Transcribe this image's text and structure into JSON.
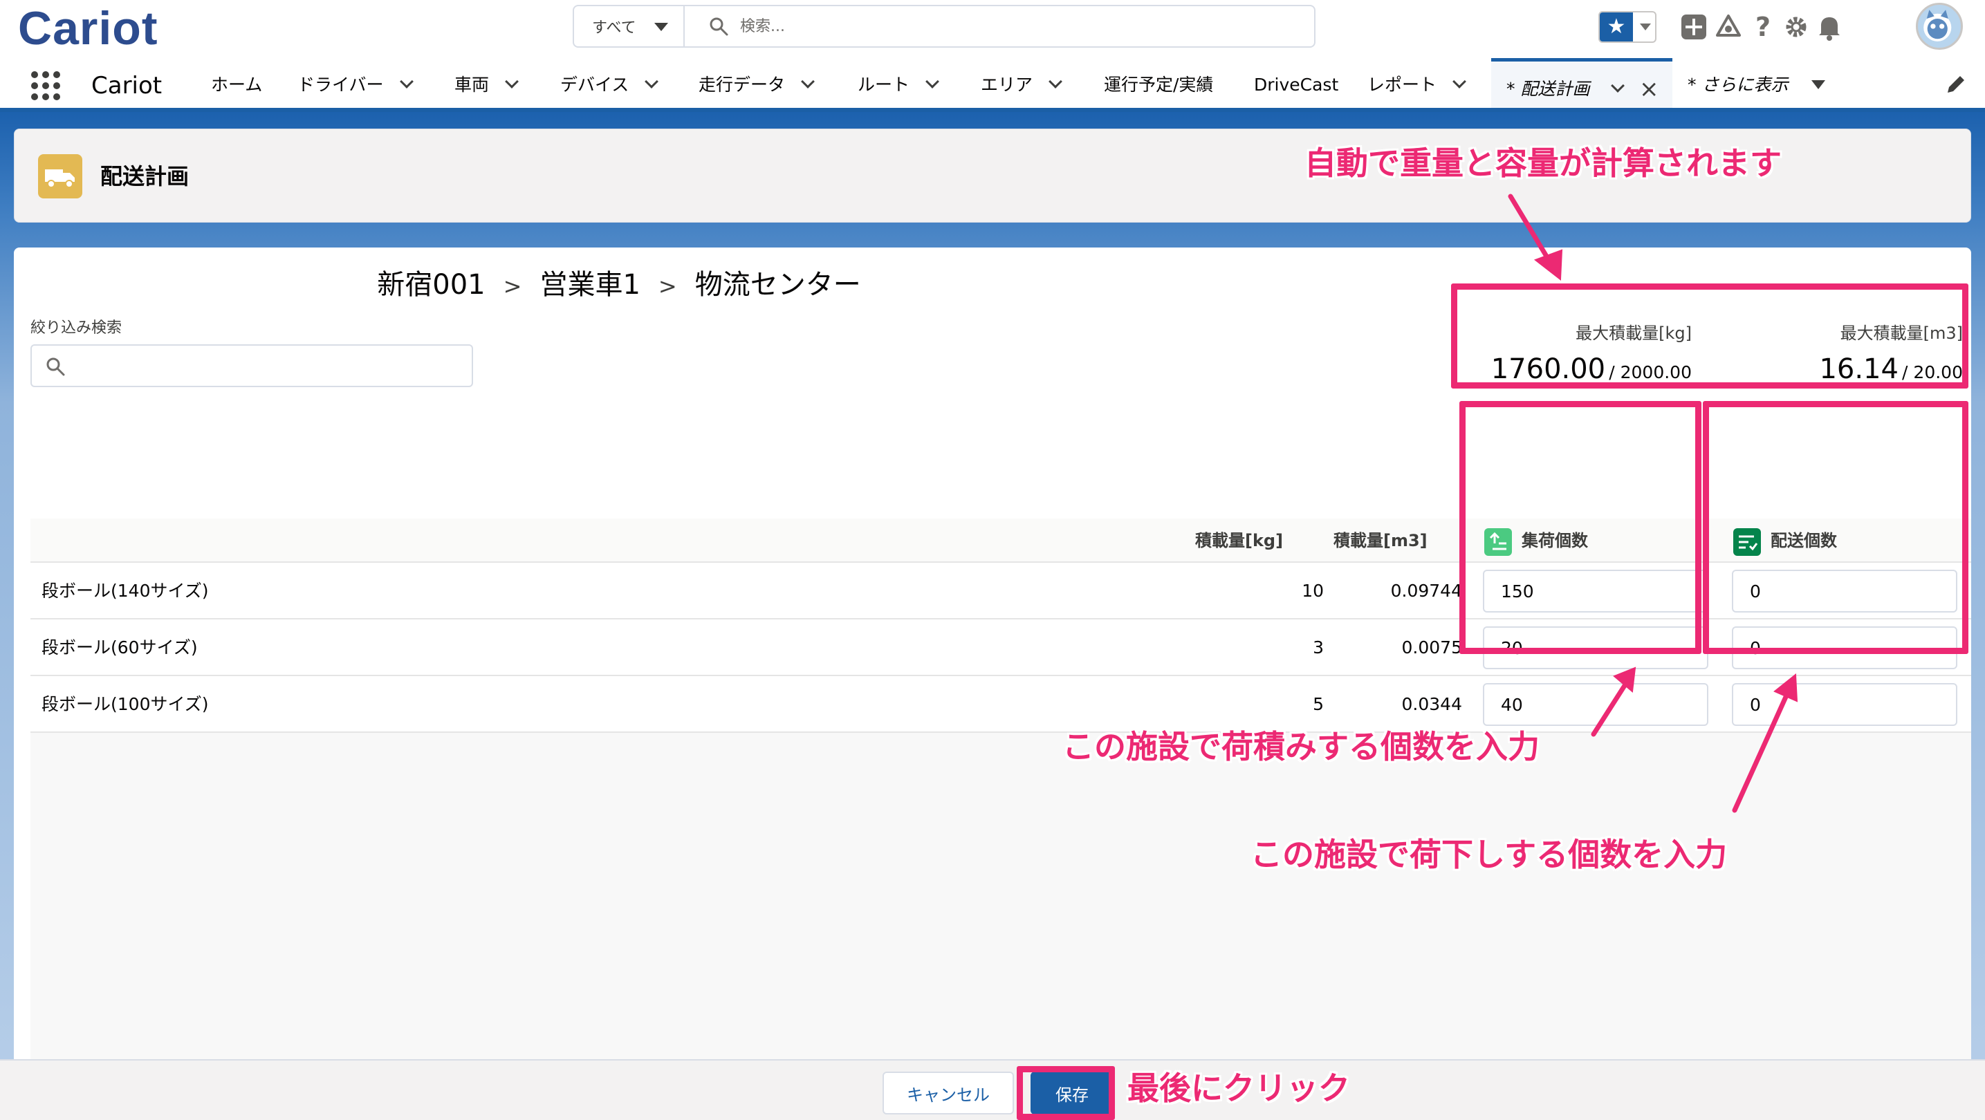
{
  "header": {
    "logo": "Cariot",
    "search_scope": "すべて",
    "search_placeholder": "検索...",
    "icons": [
      "favorites-star-icon",
      "add-icon",
      "trailhead-icon",
      "help-icon",
      "setup-gear-icon",
      "notification-bell-icon",
      "user-avatar"
    ]
  },
  "nav": {
    "app_name": "Cariot",
    "items": [
      {
        "label": "ホーム",
        "has_menu": false
      },
      {
        "label": "ドライバー",
        "has_menu": true
      },
      {
        "label": "車両",
        "has_menu": true
      },
      {
        "label": "デバイス",
        "has_menu": true
      },
      {
        "label": "走行データ",
        "has_menu": true
      },
      {
        "label": "ルート",
        "has_menu": true
      },
      {
        "label": "エリア",
        "has_menu": true
      },
      {
        "label": "運行予定/実績",
        "has_menu": false
      },
      {
        "label": "DriveCast",
        "has_menu": false
      },
      {
        "label": "レポート",
        "has_menu": true
      }
    ],
    "active_tab": "* 配送計画",
    "more": "* さらに表示"
  },
  "page": {
    "title": "配送計画",
    "accent_color": "#e3b953"
  },
  "breadcrumb": {
    "parts": [
      "新宿001",
      "営業車1",
      "物流センター"
    ],
    "separator": ">"
  },
  "filter": {
    "label": "絞り込み検索",
    "placeholder": ""
  },
  "capacity": {
    "weight_label": "最大積載量[kg]",
    "weight_current": "1760.00",
    "weight_max": "/ 2000.00",
    "volume_label": "最大積載量[m3]",
    "volume_current": "16.14",
    "volume_max": "/ 20.00"
  },
  "table": {
    "columns": {
      "weight": "積載量[kg]",
      "volume": "積載量[m3]",
      "pickup": "集荷個数",
      "delivery": "配送個数"
    },
    "rows": [
      {
        "name": "段ボール(140サイズ)",
        "weight": "10",
        "volume": "0.09744",
        "pickup": "150",
        "delivery": "0"
      },
      {
        "name": "段ボール(60サイズ)",
        "weight": "3",
        "volume": "0.0075",
        "pickup": "20",
        "delivery": "0"
      },
      {
        "name": "段ボール(100サイズ)",
        "weight": "5",
        "volume": "0.0344",
        "pickup": "40",
        "delivery": "0"
      }
    ]
  },
  "annotations": {
    "auto_calc": "自動で重量と容量が計算されます",
    "pickup_hint": "この施設で荷積みする個数を入力",
    "delivery_hint": "この施設で荷下しする個数を入力",
    "click_last": "最後にクリック",
    "color": "#ec2973"
  },
  "footer": {
    "cancel_label": "キャンセル",
    "save_label": "保存"
  },
  "colors": {
    "brand_blue": "#1b5fa6",
    "pickup_icon": "#4bca81",
    "delivery_icon": "#04844b"
  }
}
